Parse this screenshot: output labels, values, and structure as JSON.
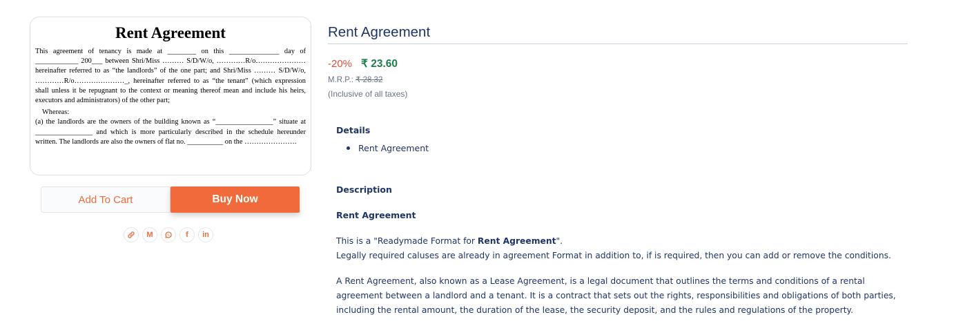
{
  "document_preview": {
    "title": "Rent Agreement",
    "lines": [
      "This agreement of tenancy is made at ________ on this ______________ day of ____________ 200___ between Shri/Miss ……… S/D/W/o, …………R/o…………………hereinafter referred to as “the landlords” of the one part; and Shri/Miss ……… S/D/W/o, …………R/o…………………_, hereinafter referred to as “the tenant” (which expression shall unless it be repugnant to the context or meaning thereof mean and include his heirs, executors and administrators) of the other part;",
      "Whereas:",
      "(a)     the landlords are the owners of the building known as “________________” situate at ________________ and which is more particularly described in the schedule hereunder written. The landlords are also the owners of flat no. __________ on the …………………."
    ]
  },
  "actions": {
    "add_to_cart": "Add To Cart",
    "buy_now": "Buy Now"
  },
  "share": {
    "icons": [
      "link-icon",
      "gmail-icon",
      "whatsapp-icon",
      "facebook-icon",
      "linkedin-icon"
    ],
    "gmail_glyph": "M",
    "facebook_glyph": "f",
    "linkedin_glyph": "in"
  },
  "product": {
    "title": "Rent Agreement",
    "discount": "-20%",
    "price": "₹ 23.60",
    "mrp_label": "M.R.P.:",
    "mrp_value": "₹ 28.32",
    "tax_note": "(Inclusive of all taxes)"
  },
  "details": {
    "heading": "Details",
    "items": [
      "Rent Agreement"
    ]
  },
  "description": {
    "heading": "Description",
    "subheading": "Rent Agreement",
    "intro_prefix": "This is a \"Readymade Format for ",
    "intro_bold": "Rent Agreement",
    "intro_suffix": "\".",
    "line2": "Legally required caluses are already in agreement Format in addition to, if is required, then you can add or remove the conditions.",
    "para2": "A Rent Agreement, also known as a Lease Agreement, is a legal document that outlines the terms and conditions of a rental agreement between a landlord and a tenant. It is a contract that sets out the rights, responsibilities and obligations of both parties, including the rental amount, the duration of the lease, the security deposit, and the rules and regulations of the property."
  },
  "colors": {
    "accent": "#f06a3b",
    "price_green": "#1d7f4a",
    "discount_red": "#e24a3b",
    "text_navy": "#1f3566"
  }
}
